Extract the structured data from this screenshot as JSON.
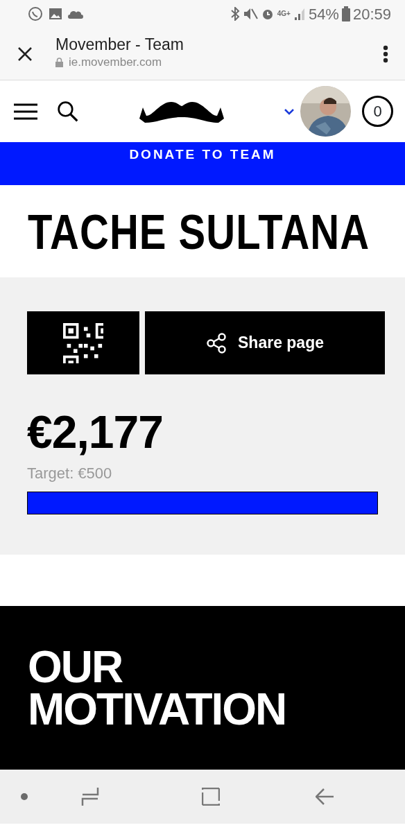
{
  "status_bar": {
    "network": "4G+",
    "battery": "54%",
    "time": "20:59"
  },
  "browser": {
    "title": "Movember - Team",
    "url": "ie.movember.com"
  },
  "header": {
    "cart_count": "0"
  },
  "donate_button": {
    "label": "DONATE TO TEAM"
  },
  "team": {
    "name": "TACHE SULTANA"
  },
  "share_button": {
    "label": "Share page"
  },
  "progress": {
    "amount": "€2,177",
    "target": "Target: €500",
    "level": 1.0
  },
  "motivation": {
    "heading_lines": [
      "OUR",
      "MOTIVATION"
    ]
  }
}
